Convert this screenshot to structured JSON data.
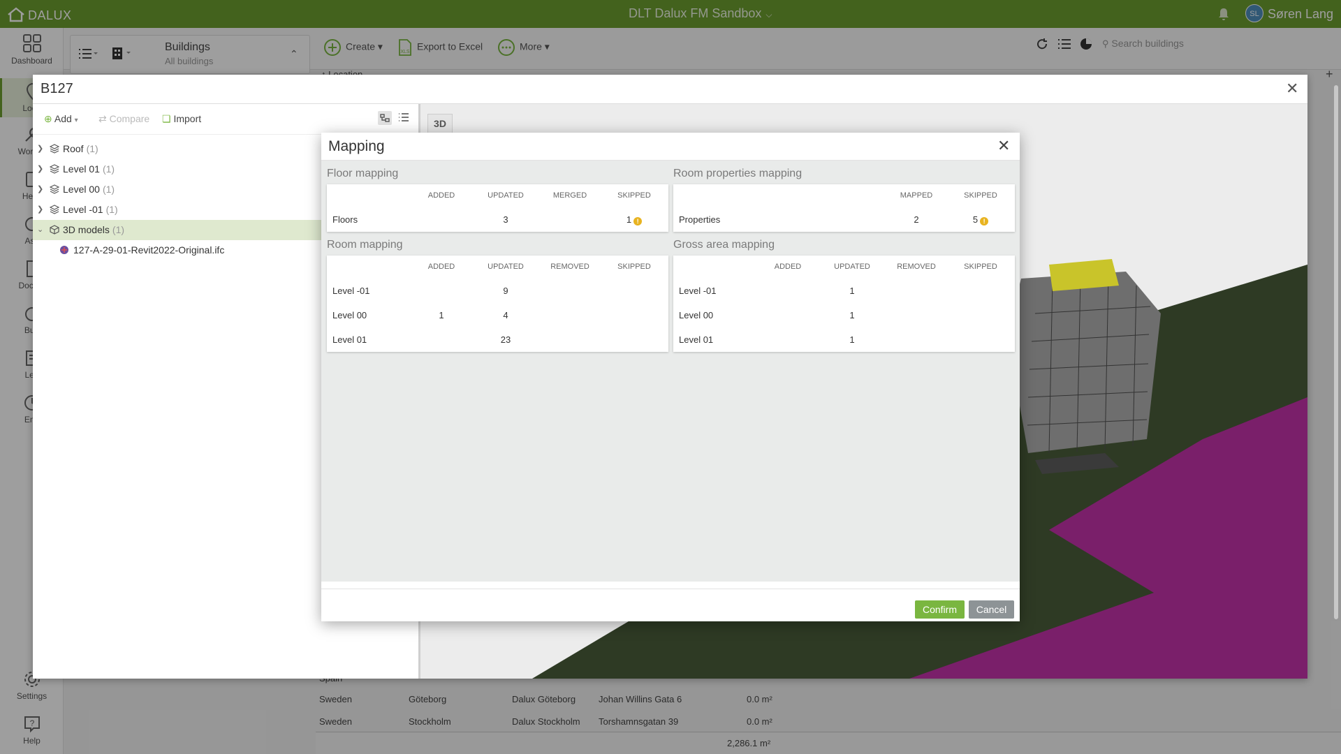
{
  "app": {
    "logo_text": "DALUX",
    "title": "DLT Dalux FM Sandbox",
    "user_initials": "SL",
    "user_name": "Søren Lang"
  },
  "leftnav": {
    "items": [
      {
        "label": "Dashboard"
      },
      {
        "label": "Locat"
      },
      {
        "label": "Work C"
      },
      {
        "label": "Helpl"
      },
      {
        "label": "Ass"
      },
      {
        "label": "Docum"
      },
      {
        "label": "Bud"
      },
      {
        "label": "Lea"
      },
      {
        "label": "Ene"
      },
      {
        "label": "Settings"
      },
      {
        "label": "Help"
      }
    ]
  },
  "toolbar": {
    "selector_title": "Buildings",
    "selector_sub": "All buildings",
    "create": "Create",
    "export": "Export to Excel",
    "more": "More",
    "search_placeholder": "Search buildings",
    "location_header": "Location"
  },
  "bg_rows": [
    {
      "country": "Spain",
      "city": "",
      "name": "",
      "address": "",
      "area": ""
    },
    {
      "country": "Sweden",
      "city": "Göteborg",
      "name": "Dalux Göteborg",
      "address": "Johan Willins Gata 6",
      "area": "0.0 m²"
    },
    {
      "country": "Sweden",
      "city": "Stockholm",
      "name": "Dalux Stockholm",
      "address": "Torshamnsgatan 39",
      "area": "0.0 m²"
    }
  ],
  "bg_total": "2,286.1 m²",
  "panel": {
    "title": "B127",
    "add": "Add",
    "compare": "Compare",
    "import": "Import",
    "viewer_3d": "3D",
    "tree": [
      {
        "label": "Roof",
        "count": "(1)"
      },
      {
        "label": "Level 01",
        "count": "(1)"
      },
      {
        "label": "Level 00",
        "count": "(1)"
      },
      {
        "label": "Level -01",
        "count": "(1)"
      },
      {
        "label": "3D models",
        "count": "(1)"
      },
      {
        "label": "127-A-29-01-Revit2022-Original.ifc",
        "count": ""
      }
    ]
  },
  "dialog": {
    "title": "Mapping",
    "confirm": "Confirm",
    "cancel": "Cancel",
    "floor": {
      "title": "Floor mapping",
      "cols": [
        "ADDED",
        "UPDATED",
        "MERGED",
        "SKIPPED"
      ],
      "rows": [
        {
          "label": "Floors",
          "added": "",
          "updated": "3",
          "merged": "",
          "skipped": "1"
        }
      ]
    },
    "room_props": {
      "title": "Room properties mapping",
      "cols": [
        "MAPPED",
        "SKIPPED"
      ],
      "rows": [
        {
          "label": "Properties",
          "mapped": "2",
          "skipped": "5"
        }
      ]
    },
    "room": {
      "title": "Room mapping",
      "cols": [
        "ADDED",
        "UPDATED",
        "REMOVED",
        "SKIPPED"
      ],
      "rows": [
        {
          "label": "Level -01",
          "added": "",
          "updated": "9",
          "removed": "",
          "skipped": ""
        },
        {
          "label": "Level 00",
          "added": "1",
          "updated": "4",
          "removed": "",
          "skipped": ""
        },
        {
          "label": "Level 01",
          "added": "",
          "updated": "23",
          "removed": "",
          "skipped": ""
        }
      ]
    },
    "gross": {
      "title": "Gross area mapping",
      "cols": [
        "ADDED",
        "UPDATED",
        "REMOVED",
        "SKIPPED"
      ],
      "rows": [
        {
          "label": "Level -01",
          "added": "",
          "updated": "1",
          "removed": "",
          "skipped": ""
        },
        {
          "label": "Level 00",
          "added": "",
          "updated": "1",
          "removed": "",
          "skipped": ""
        },
        {
          "label": "Level 01",
          "added": "",
          "updated": "1",
          "removed": "",
          "skipped": ""
        }
      ]
    }
  }
}
